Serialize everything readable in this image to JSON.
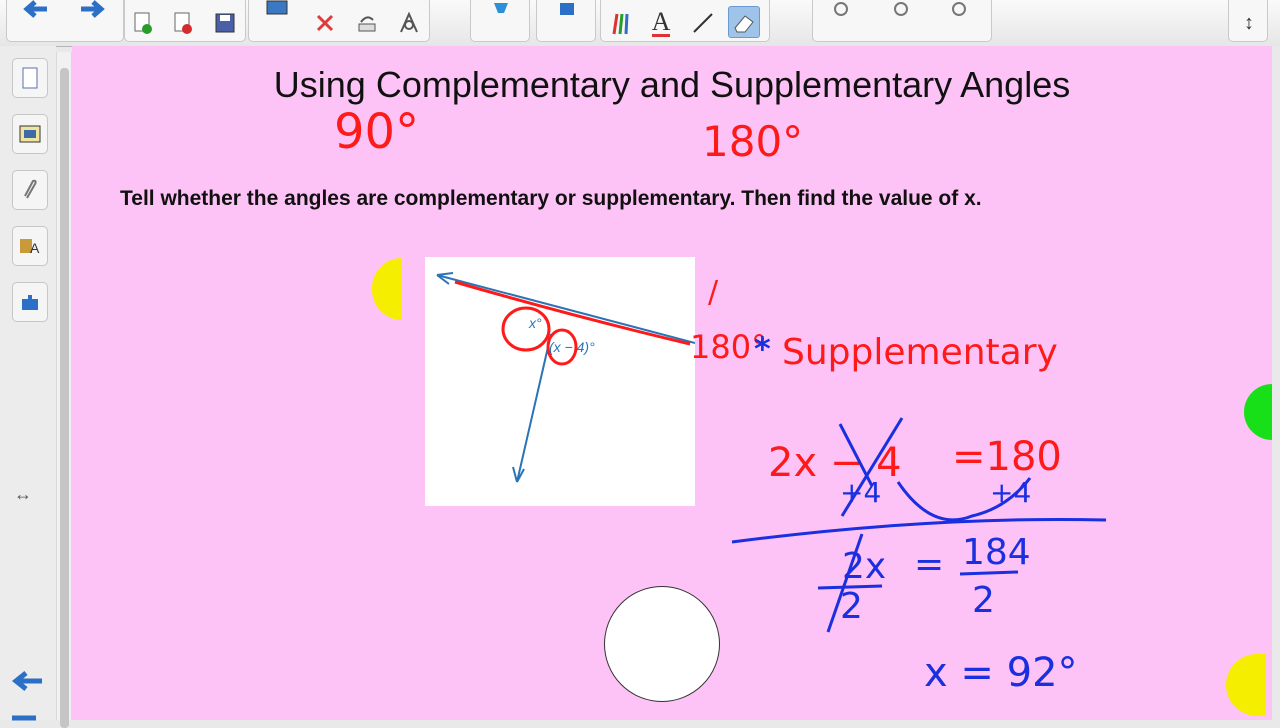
{
  "toolbar": {
    "buttons": [
      "back-icon",
      "forward-icon",
      "new-page-icon",
      "delete-page-icon",
      "save-icon",
      "screen-shade-icon",
      "delete-icon",
      "undo-icon",
      "properties-icon",
      "select-icon",
      "capture-icon",
      "pens-icon",
      "text-icon",
      "line-icon",
      "eraser-icon",
      "fill-icon",
      "shape-icon",
      "magic-pen-icon",
      "resize-icon"
    ],
    "text_tool_label": "A",
    "resize_label": "↕"
  },
  "sidebar": {
    "buttons": [
      "page-sorter-icon",
      "gallery-icon",
      "attachments-icon",
      "properties-icon",
      "addons-icon"
    ],
    "splitter_label": "≡",
    "resize_label": "↔"
  },
  "page": {
    "background": "#fec3f6",
    "title": "Using Complementary and Supplementary Angles",
    "instruction": "Tell whether the angles are complementary or supplementary.  Then find the value of x.",
    "diagram": {
      "angle_label_1": "x°",
      "angle_label_2": "(x − 4)°"
    },
    "annotations": {
      "complementary_total": "90°",
      "supplementary_total": "180°",
      "line_sum": "180°",
      "answer_type": "Supplementary",
      "equation_left": "2x − 4",
      "equation_right": "=180",
      "add_left": "+4",
      "add_right": "+4",
      "divide_left": "2x",
      "divide_left_den": "2",
      "divide_eq": "=",
      "divide_num": "184",
      "divide_den": "2",
      "solution": "x = 92°",
      "tick_mark": "/"
    },
    "ink_colors": {
      "red": "#ff1a1a",
      "blue": "#1a2fe0"
    }
  }
}
